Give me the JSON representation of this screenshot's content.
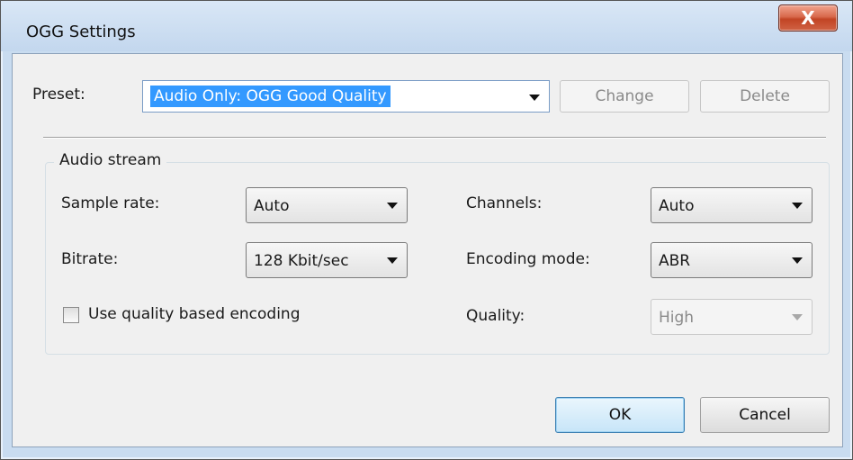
{
  "window": {
    "title": "OGG Settings",
    "close_glyph": "X"
  },
  "preset": {
    "label": "Preset:",
    "selected": "Audio Only: OGG Good Quality",
    "change_label": "Change",
    "delete_label": "Delete"
  },
  "audio_stream": {
    "title": "Audio stream",
    "sample_rate": {
      "label": "Sample rate:",
      "value": "Auto"
    },
    "bitrate": {
      "label": "Bitrate:",
      "value": "128 Kbit/sec"
    },
    "quality_based": {
      "label": "Use quality based encoding",
      "checked": false
    },
    "channels": {
      "label": "Channels:",
      "value": "Auto"
    },
    "encoding_mode": {
      "label": "Encoding mode:",
      "value": "ABR"
    },
    "quality": {
      "label": "Quality:",
      "value": "High",
      "disabled": true
    }
  },
  "footer": {
    "ok_label": "OK",
    "cancel_label": "Cancel"
  },
  "colors": {
    "selection": "#3399ff",
    "close_button": "#c24424",
    "window_frame": "#c9dcf0"
  }
}
